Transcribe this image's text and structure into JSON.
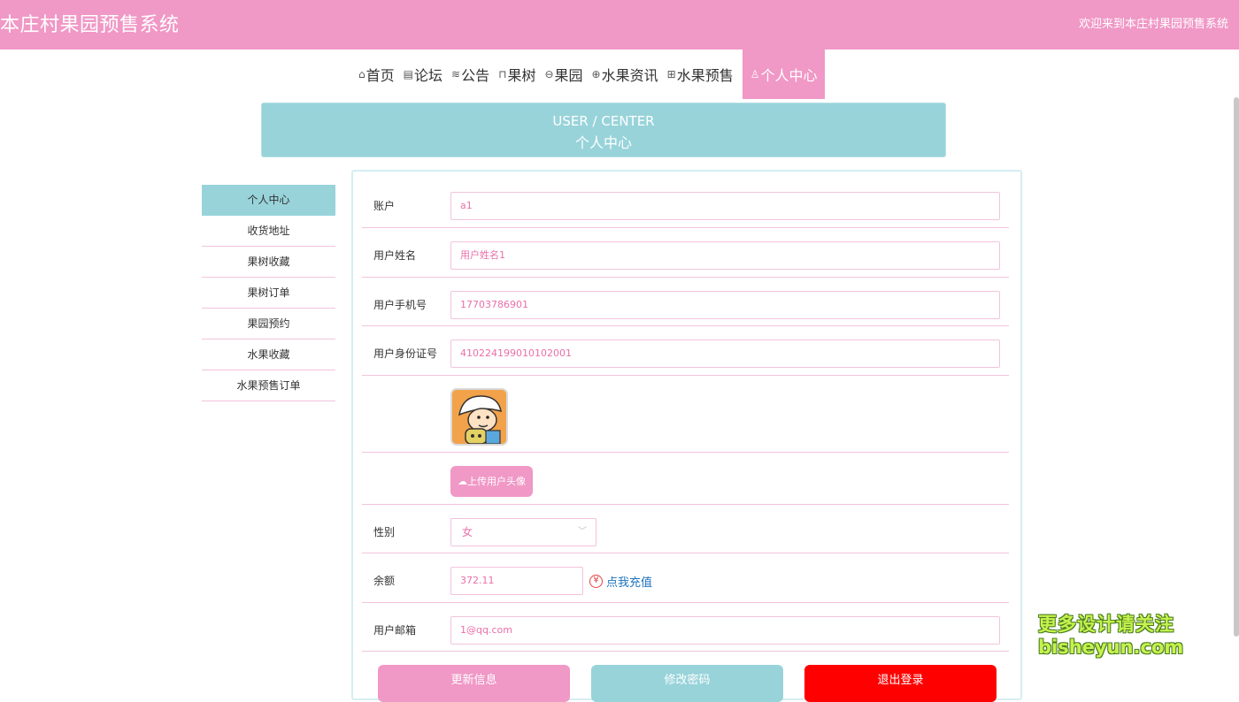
{
  "header": {
    "title": "本庄村果园预售系统",
    "welcome": "欢迎来到本庄村果园预售系统"
  },
  "nav": {
    "items": [
      {
        "label": "首页",
        "icon": "home-icon"
      },
      {
        "label": "论坛",
        "icon": "forum-icon"
      },
      {
        "label": "公告",
        "icon": "stack-icon"
      },
      {
        "label": "果树",
        "icon": "tree-icon"
      },
      {
        "label": "果园",
        "icon": "orchard-icon"
      },
      {
        "label": "水果资讯",
        "icon": "globe-icon"
      },
      {
        "label": "水果预售",
        "icon": "grid-icon"
      },
      {
        "label": "个人中心",
        "icon": "user-icon"
      }
    ],
    "active_index": 7
  },
  "banner": {
    "en": "USER / CENTER",
    "cn": "个人中心"
  },
  "sidebar": {
    "items": [
      {
        "label": "个人中心"
      },
      {
        "label": "收货地址"
      },
      {
        "label": "果树收藏"
      },
      {
        "label": "果树订单"
      },
      {
        "label": "果园预约"
      },
      {
        "label": "水果收藏"
      },
      {
        "label": "水果预售订单"
      }
    ]
  },
  "form": {
    "account": {
      "label": "账户",
      "value": "a1"
    },
    "name": {
      "label": "用户姓名",
      "value": "用户姓名1"
    },
    "phone": {
      "label": "用户手机号",
      "value": "17703786901"
    },
    "idcard": {
      "label": "用户身份证号",
      "value": "410224199010102001"
    },
    "upload_label": "上传用户头像",
    "gender": {
      "label": "性别",
      "value": "女"
    },
    "balance": {
      "label": "余额",
      "value": "372.11",
      "recharge": "点我充值",
      "yen": "¥"
    },
    "email": {
      "label": "用户邮箱",
      "value": "1@qq.com"
    }
  },
  "buttons": {
    "update": "更新信息",
    "password": "修改密码",
    "logout": "退出登录"
  },
  "colors": {
    "pink": "#f098c6",
    "teal": "#98d3da",
    "red": "#ff0000"
  },
  "watermark": {
    "line1": "更多设计请关注",
    "line2": "bisheyun.com"
  }
}
